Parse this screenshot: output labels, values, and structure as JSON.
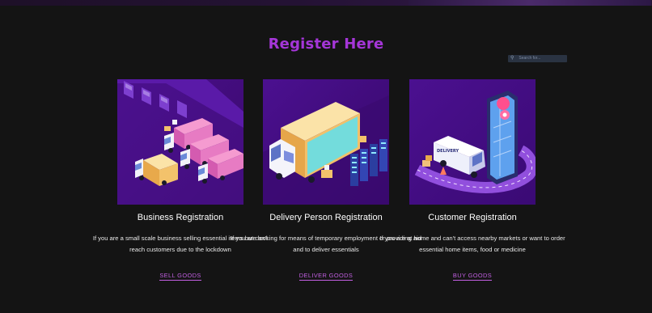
{
  "title": "Register Here",
  "search": {
    "placeholder": "Search for..."
  },
  "cards": [
    {
      "heading": "Business Registration",
      "text": "If you are a small scale business selling essential items but can't reach customers due to the lockdown",
      "link": "SELL GOODS",
      "image_icon": "delivery-trucks-warehouse-illustration"
    },
    {
      "heading": "Delivery Person Registration",
      "text": "If you are looking for means of temporary employment or providing aid and to deliver essentials",
      "link": "DELIVER GOODS",
      "image_icon": "cargo-truck-loading-illustration"
    },
    {
      "heading": "Customer Registration",
      "text": "If you are at home and can't access nearby markets or want to order essential home items, food or medicine",
      "link": "BUY GOODS",
      "image_icon": "van-phone-map-illustration",
      "van_label": "DELIVERY"
    }
  ],
  "colors": {
    "accent": "#a536d8",
    "link": "#c25fe2",
    "background": "#141414",
    "card_bg": "#3e0a78"
  }
}
